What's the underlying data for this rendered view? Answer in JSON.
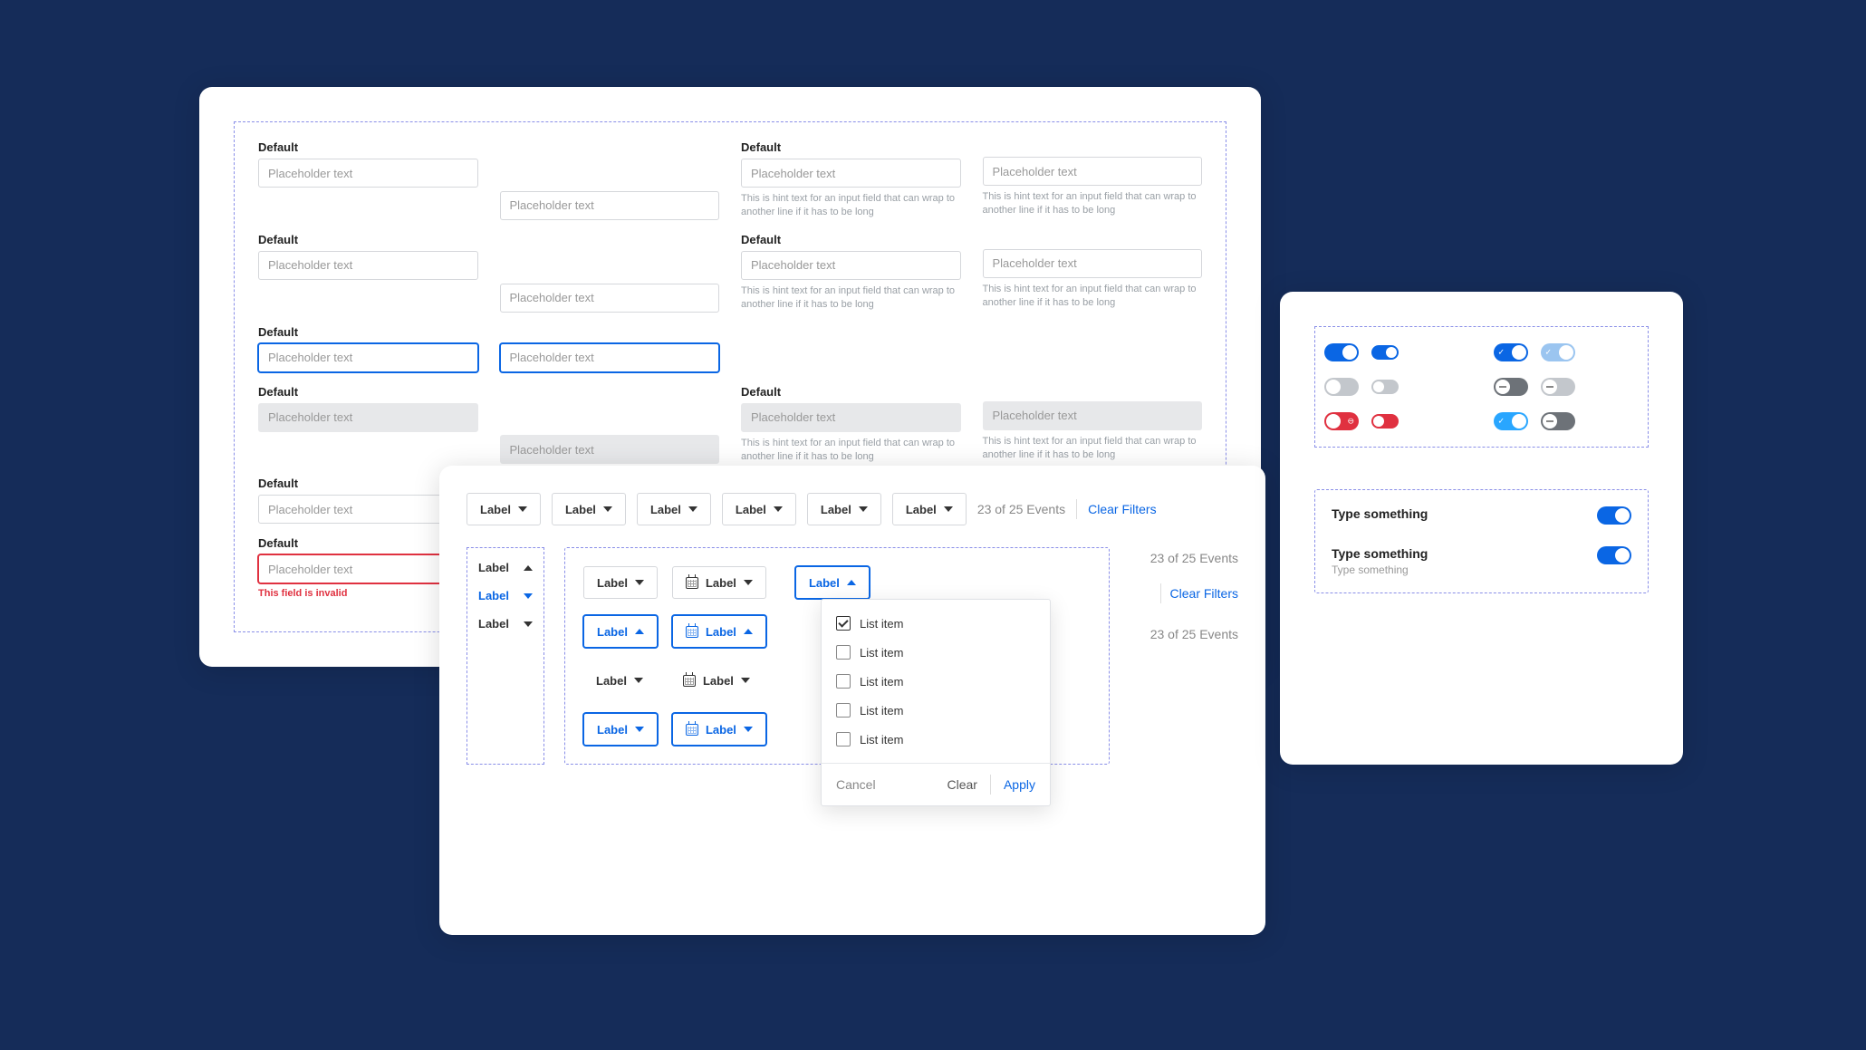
{
  "inputs": {
    "left": [
      {
        "label": "Default",
        "placeholder": "Placeholder text",
        "state": "normal"
      },
      {
        "label": "Default",
        "placeholder": "Placeholder text",
        "state": "normal"
      },
      {
        "label": "Default",
        "placeholder": "Placeholder text",
        "state": "focus"
      },
      {
        "label": "Default",
        "placeholder": "Placeholder text",
        "state": "disabled"
      },
      {
        "label": "Default",
        "placeholder": "Placeholder text",
        "state": "chevron"
      },
      {
        "label": "Default",
        "placeholder": "Placeholder text",
        "state": "error",
        "error": "This field is invalid"
      }
    ],
    "left2": [
      {
        "placeholder": "Placeholder text",
        "state": "normal"
      },
      {
        "placeholder": "Placeholder text",
        "state": "normal"
      },
      {
        "placeholder": "Placeholder text",
        "state": "focus"
      },
      {
        "placeholder": "Placeholder text",
        "state": "disabled"
      }
    ],
    "right": [
      {
        "label": "Default",
        "placeholder": "Placeholder text",
        "hint": "This is hint text for an input field that can wrap to another line if it has to be long",
        "state": "normal"
      },
      {
        "label": "Default",
        "placeholder": "Placeholder text",
        "hint": "This is hint text for an input field that can wrap to another line if it has to be long",
        "state": "normal"
      },
      {
        "label": "Default",
        "placeholder": "Placeholder text",
        "hint": "This is hint text for an input field that can wrap to another line if it has to be long",
        "state": "disabled"
      }
    ],
    "right2": [
      {
        "placeholder": "Placeholder text",
        "hint": "This is hint text for an input field that can wrap to another line if it has to be long",
        "state": "normal"
      },
      {
        "placeholder": "Placeholder text",
        "hint": "This is hint text for an input field that can wrap to another line if it has to be long",
        "state": "normal"
      },
      {
        "placeholder": "Placeholder text",
        "hint": "This is hint text for an input field that can wrap to another line if it has to be long",
        "state": "disabled"
      }
    ]
  },
  "filters": {
    "topPills": [
      "Label",
      "Label",
      "Label",
      "Label",
      "Label",
      "Label"
    ],
    "countText": "23 of 25 Events",
    "clearLabel": "Clear Filters",
    "labelsCol": [
      {
        "text": "Label",
        "dir": "up",
        "active": false
      },
      {
        "text": "Label",
        "dir": "down",
        "active": true
      },
      {
        "text": "Label",
        "dir": "down",
        "active": false
      }
    ],
    "gridRows": [
      [
        {
          "text": "Label",
          "dir": "down",
          "icon": null,
          "active": false
        },
        {
          "text": "Label",
          "dir": "down",
          "icon": "cal",
          "active": false
        }
      ],
      [
        {
          "text": "Label",
          "dir": "up",
          "icon": null,
          "active": true
        },
        {
          "text": "Label",
          "dir": "up",
          "icon": "cal",
          "active": true
        }
      ],
      [
        {
          "text": "Label",
          "dir": "down",
          "icon": null,
          "active": false
        },
        {
          "text": "Label",
          "dir": "down",
          "icon": "cal",
          "active": false
        }
      ],
      [
        {
          "text": "Label",
          "dir": "down",
          "icon": null,
          "active": true
        },
        {
          "text": "Label",
          "dir": "down",
          "icon": "cal",
          "active": true
        }
      ]
    ],
    "openPill": {
      "text": "Label",
      "dir": "up"
    },
    "dropdown": {
      "items": [
        {
          "text": "List item",
          "checked": true
        },
        {
          "text": "List item",
          "checked": false
        },
        {
          "text": "List item",
          "checked": false
        },
        {
          "text": "List item",
          "checked": false
        },
        {
          "text": "List item",
          "checked": false
        }
      ],
      "cancel": "Cancel",
      "clear": "Clear",
      "apply": "Apply"
    },
    "sideCounts": [
      "23 of 25 Events",
      "Clear Filters",
      "23 of 25 Events"
    ]
  },
  "toggles": {
    "settings": [
      {
        "label": "Type something",
        "sub": null
      },
      {
        "label": "Type something",
        "sub": "Type something"
      }
    ]
  }
}
